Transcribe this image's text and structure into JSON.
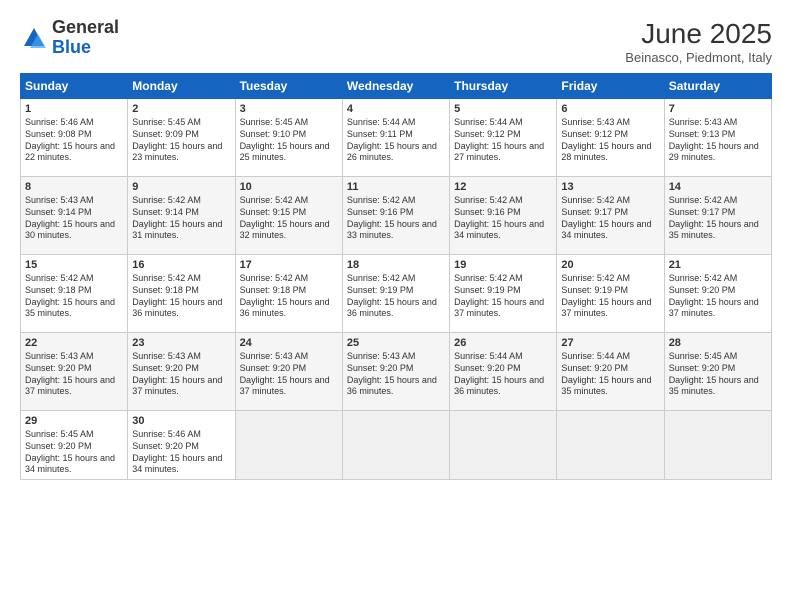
{
  "header": {
    "logo": {
      "line1": "General",
      "line2": "Blue"
    },
    "title": "June 2025",
    "subtitle": "Beinasco, Piedmont, Italy"
  },
  "days_of_week": [
    "Sunday",
    "Monday",
    "Tuesday",
    "Wednesday",
    "Thursday",
    "Friday",
    "Saturday"
  ],
  "weeks": [
    [
      {
        "day": "1",
        "sunrise": "Sunrise: 5:46 AM",
        "sunset": "Sunset: 9:08 PM",
        "daylight": "Daylight: 15 hours and 22 minutes."
      },
      {
        "day": "2",
        "sunrise": "Sunrise: 5:45 AM",
        "sunset": "Sunset: 9:09 PM",
        "daylight": "Daylight: 15 hours and 23 minutes."
      },
      {
        "day": "3",
        "sunrise": "Sunrise: 5:45 AM",
        "sunset": "Sunset: 9:10 PM",
        "daylight": "Daylight: 15 hours and 25 minutes."
      },
      {
        "day": "4",
        "sunrise": "Sunrise: 5:44 AM",
        "sunset": "Sunset: 9:11 PM",
        "daylight": "Daylight: 15 hours and 26 minutes."
      },
      {
        "day": "5",
        "sunrise": "Sunrise: 5:44 AM",
        "sunset": "Sunset: 9:12 PM",
        "daylight": "Daylight: 15 hours and 27 minutes."
      },
      {
        "day": "6",
        "sunrise": "Sunrise: 5:43 AM",
        "sunset": "Sunset: 9:12 PM",
        "daylight": "Daylight: 15 hours and 28 minutes."
      },
      {
        "day": "7",
        "sunrise": "Sunrise: 5:43 AM",
        "sunset": "Sunset: 9:13 PM",
        "daylight": "Daylight: 15 hours and 29 minutes."
      }
    ],
    [
      {
        "day": "8",
        "sunrise": "Sunrise: 5:43 AM",
        "sunset": "Sunset: 9:14 PM",
        "daylight": "Daylight: 15 hours and 30 minutes."
      },
      {
        "day": "9",
        "sunrise": "Sunrise: 5:42 AM",
        "sunset": "Sunset: 9:14 PM",
        "daylight": "Daylight: 15 hours and 31 minutes."
      },
      {
        "day": "10",
        "sunrise": "Sunrise: 5:42 AM",
        "sunset": "Sunset: 9:15 PM",
        "daylight": "Daylight: 15 hours and 32 minutes."
      },
      {
        "day": "11",
        "sunrise": "Sunrise: 5:42 AM",
        "sunset": "Sunset: 9:16 PM",
        "daylight": "Daylight: 15 hours and 33 minutes."
      },
      {
        "day": "12",
        "sunrise": "Sunrise: 5:42 AM",
        "sunset": "Sunset: 9:16 PM",
        "daylight": "Daylight: 15 hours and 34 minutes."
      },
      {
        "day": "13",
        "sunrise": "Sunrise: 5:42 AM",
        "sunset": "Sunset: 9:17 PM",
        "daylight": "Daylight: 15 hours and 34 minutes."
      },
      {
        "day": "14",
        "sunrise": "Sunrise: 5:42 AM",
        "sunset": "Sunset: 9:17 PM",
        "daylight": "Daylight: 15 hours and 35 minutes."
      }
    ],
    [
      {
        "day": "15",
        "sunrise": "Sunrise: 5:42 AM",
        "sunset": "Sunset: 9:18 PM",
        "daylight": "Daylight: 15 hours and 35 minutes."
      },
      {
        "day": "16",
        "sunrise": "Sunrise: 5:42 AM",
        "sunset": "Sunset: 9:18 PM",
        "daylight": "Daylight: 15 hours and 36 minutes."
      },
      {
        "day": "17",
        "sunrise": "Sunrise: 5:42 AM",
        "sunset": "Sunset: 9:18 PM",
        "daylight": "Daylight: 15 hours and 36 minutes."
      },
      {
        "day": "18",
        "sunrise": "Sunrise: 5:42 AM",
        "sunset": "Sunset: 9:19 PM",
        "daylight": "Daylight: 15 hours and 36 minutes."
      },
      {
        "day": "19",
        "sunrise": "Sunrise: 5:42 AM",
        "sunset": "Sunset: 9:19 PM",
        "daylight": "Daylight: 15 hours and 37 minutes."
      },
      {
        "day": "20",
        "sunrise": "Sunrise: 5:42 AM",
        "sunset": "Sunset: 9:19 PM",
        "daylight": "Daylight: 15 hours and 37 minutes."
      },
      {
        "day": "21",
        "sunrise": "Sunrise: 5:42 AM",
        "sunset": "Sunset: 9:20 PM",
        "daylight": "Daylight: 15 hours and 37 minutes."
      }
    ],
    [
      {
        "day": "22",
        "sunrise": "Sunrise: 5:43 AM",
        "sunset": "Sunset: 9:20 PM",
        "daylight": "Daylight: 15 hours and 37 minutes."
      },
      {
        "day": "23",
        "sunrise": "Sunrise: 5:43 AM",
        "sunset": "Sunset: 9:20 PM",
        "daylight": "Daylight: 15 hours and 37 minutes."
      },
      {
        "day": "24",
        "sunrise": "Sunrise: 5:43 AM",
        "sunset": "Sunset: 9:20 PM",
        "daylight": "Daylight: 15 hours and 37 minutes."
      },
      {
        "day": "25",
        "sunrise": "Sunrise: 5:43 AM",
        "sunset": "Sunset: 9:20 PM",
        "daylight": "Daylight: 15 hours and 36 minutes."
      },
      {
        "day": "26",
        "sunrise": "Sunrise: 5:44 AM",
        "sunset": "Sunset: 9:20 PM",
        "daylight": "Daylight: 15 hours and 36 minutes."
      },
      {
        "day": "27",
        "sunrise": "Sunrise: 5:44 AM",
        "sunset": "Sunset: 9:20 PM",
        "daylight": "Daylight: 15 hours and 35 minutes."
      },
      {
        "day": "28",
        "sunrise": "Sunrise: 5:45 AM",
        "sunset": "Sunset: 9:20 PM",
        "daylight": "Daylight: 15 hours and 35 minutes."
      }
    ],
    [
      {
        "day": "29",
        "sunrise": "Sunrise: 5:45 AM",
        "sunset": "Sunset: 9:20 PM",
        "daylight": "Daylight: 15 hours and 34 minutes."
      },
      {
        "day": "30",
        "sunrise": "Sunrise: 5:46 AM",
        "sunset": "Sunset: 9:20 PM",
        "daylight": "Daylight: 15 hours and 34 minutes."
      },
      null,
      null,
      null,
      null,
      null
    ]
  ]
}
